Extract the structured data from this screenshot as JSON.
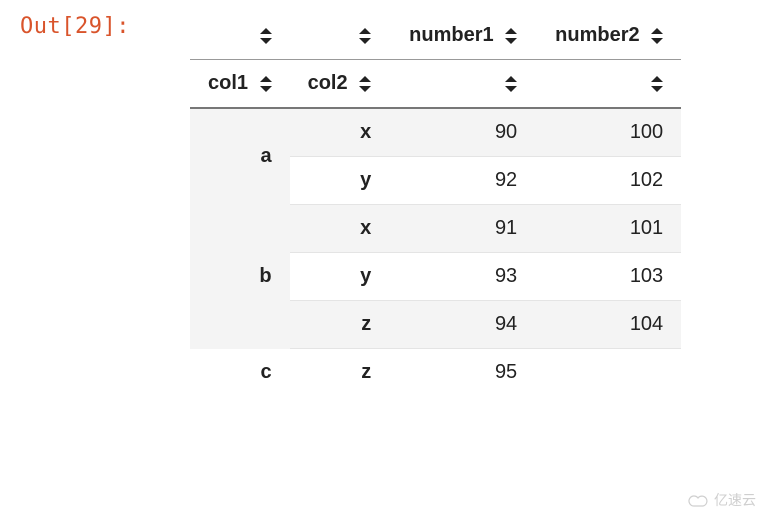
{
  "prompt": "Out[29]:",
  "columns": {
    "number1": "number1",
    "number2": "number2"
  },
  "index_names": {
    "col1": "col1",
    "col2": "col2"
  },
  "rows": [
    {
      "col1": "a",
      "col2": "x",
      "number1": 90,
      "number2": 100,
      "group_first": true,
      "group_span": 2,
      "stripe": true
    },
    {
      "col1": "a",
      "col2": "y",
      "number1": 92,
      "number2": 102,
      "group_first": false,
      "group_span": 0,
      "stripe": false
    },
    {
      "col1": "b",
      "col2": "x",
      "number1": 91,
      "number2": 101,
      "group_first": true,
      "group_span": 3,
      "stripe": true
    },
    {
      "col1": "b",
      "col2": "y",
      "number1": 93,
      "number2": 103,
      "group_first": false,
      "group_span": 0,
      "stripe": false
    },
    {
      "col1": "b",
      "col2": "z",
      "number1": 94,
      "number2": 104,
      "group_first": false,
      "group_span": 0,
      "stripe": true
    },
    {
      "col1": "c",
      "col2": "z",
      "number1": 95,
      "number2": null,
      "group_first": true,
      "group_span": 1,
      "stripe": false
    }
  ],
  "watermark": "亿速云",
  "chart_data": {
    "type": "table",
    "title": "",
    "index": [
      [
        "a",
        "x"
      ],
      [
        "a",
        "y"
      ],
      [
        "b",
        "x"
      ],
      [
        "b",
        "y"
      ],
      [
        "b",
        "z"
      ],
      [
        "c",
        "z"
      ]
    ],
    "index_names": [
      "col1",
      "col2"
    ],
    "columns": [
      "number1",
      "number2"
    ],
    "data": [
      [
        90,
        100
      ],
      [
        92,
        102
      ],
      [
        91,
        101
      ],
      [
        93,
        103
      ],
      [
        94,
        104
      ],
      [
        95,
        null
      ]
    ]
  }
}
